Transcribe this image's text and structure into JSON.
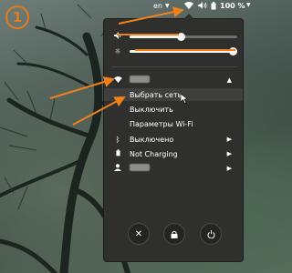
{
  "badge": "1",
  "topbar": {
    "lang": "en",
    "battery": "100 %"
  },
  "menu": {
    "network_name": "",
    "select_network": "Выбрать сеть",
    "turn_off": "Выключить",
    "wifi_settings": "Параметры Wi-Fi",
    "bluetooth": "Выключено",
    "power": "Not Charging",
    "user": ""
  },
  "colors": {
    "accent": "#f0801a"
  }
}
